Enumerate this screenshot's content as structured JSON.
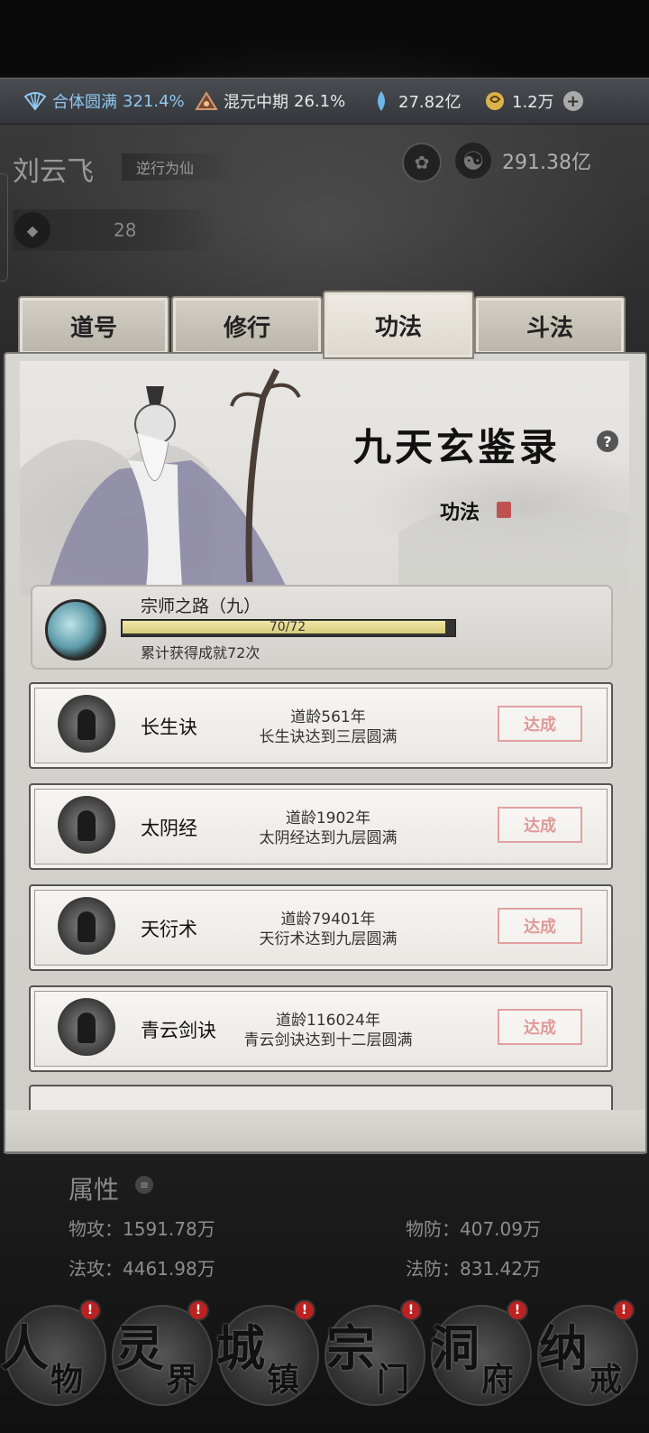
{
  "topbar": {
    "realm": "合体圆满",
    "realm_pct": "321.4%",
    "stage": "混元中期",
    "stage_pct": "26.1%",
    "spirit_stones": "27.82亿",
    "gold": "1.2万"
  },
  "profile": {
    "name": "刘云飞",
    "motto": "逆行为仙",
    "currency": "291.38亿",
    "level": "28"
  },
  "tabs": [
    "道号",
    "修行",
    "功法",
    "斗法"
  ],
  "active_tab": "功法",
  "panel": {
    "title": "九天玄鉴录",
    "subtitle": "功法",
    "help": "?"
  },
  "achievement": {
    "name": "宗师之路（九）",
    "progress_text": "70/72",
    "progress": 0.9722,
    "description": "累计获得成就72次"
  },
  "rows": [
    {
      "name": "长生诀",
      "line1": "道龄561年",
      "line2": "长生诀达到三层圆满",
      "status": "达成"
    },
    {
      "name": "太阴经",
      "line1": "道龄1902年",
      "line2": "太阴经达到九层圆满",
      "status": "达成"
    },
    {
      "name": "天衍术",
      "line1": "道龄79401年",
      "line2": "天衍术达到九层圆满",
      "status": "达成"
    },
    {
      "name": "青云剑诀",
      "line1": "道龄116024年",
      "line2": "青云剑诀达到十二层圆满",
      "status": "达成"
    }
  ],
  "attributes": {
    "title": "属性",
    "phys_atk": "物攻：1591.78万",
    "phys_def": "物防：407.09万",
    "mag_atk": "法攻：4461.98万",
    "mag_def": "法防：831.42万"
  },
  "nav": [
    {
      "big": "人",
      "small": "物"
    },
    {
      "big": "灵",
      "small": "界"
    },
    {
      "big": "城",
      "small": "镇"
    },
    {
      "big": "宗",
      "small": "门"
    },
    {
      "big": "洞",
      "small": "府"
    },
    {
      "big": "纳",
      "small": "戒"
    }
  ],
  "nav_badge": "!",
  "colors": {
    "accent_blue": "#8fc7f0",
    "done_red": "#e09a9a",
    "progress_fill": "#e8dd92"
  }
}
